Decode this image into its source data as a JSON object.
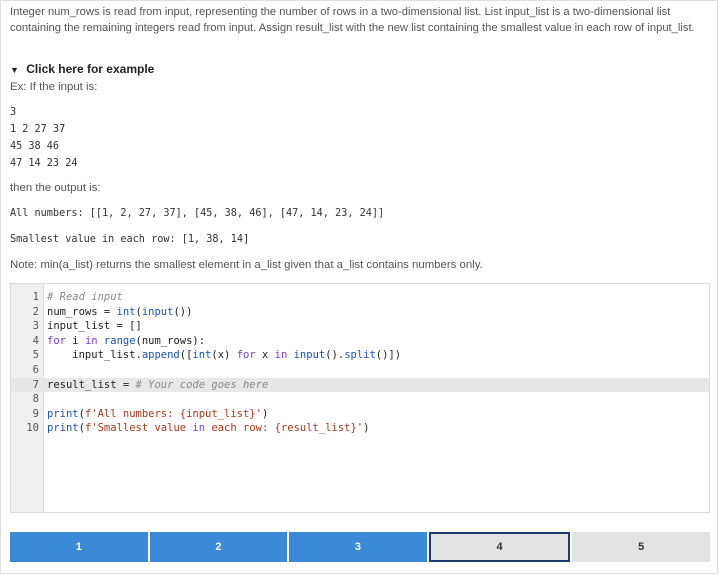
{
  "prompt": "Integer num_rows is read from input, representing the number of rows in a two-dimensional list. List input_list is a two-dimensional list containing the remaining integers read from input. Assign result_list with the new list containing the smallest value in each row of input_list.",
  "example": {
    "toggle_label": "Click here for example",
    "intro": "Ex: If the input is:",
    "input_lines": [
      "3",
      "1 2 27 37",
      "45 38 46",
      "47 14 23 24"
    ],
    "then_text": "then the output is:",
    "output_lines": [
      "All numbers: [[1, 2, 27, 37], [45, 38, 46], [47, 14, 23, 24]]",
      "Smallest value in each row: [1, 38, 14]"
    ],
    "note": "Note: min(a_list) returns the smallest element in a_list given that a_list contains numbers only."
  },
  "editor": {
    "active_line": 7,
    "lines": [
      {
        "n": "1",
        "code": "# Read input"
      },
      {
        "n": "2",
        "code": "num_rows = int(input())"
      },
      {
        "n": "3",
        "code": "input_list = []"
      },
      {
        "n": "4",
        "code": "for i in range(num_rows):"
      },
      {
        "n": "5",
        "code": "    input_list.append([int(x) for x in input().split()])"
      },
      {
        "n": "6",
        "code": ""
      },
      {
        "n": "7",
        "code": "result_list = # Your code goes here"
      },
      {
        "n": "8",
        "code": ""
      },
      {
        "n": "9",
        "code": "print(f'All numbers: {input_list}')"
      },
      {
        "n": "10",
        "code": "print(f'Smallest value in each row: {result_list}')"
      }
    ]
  },
  "progress": {
    "current": 4,
    "steps": [
      {
        "label": "1",
        "state": "completed"
      },
      {
        "label": "2",
        "state": "completed"
      },
      {
        "label": "3",
        "state": "completed"
      },
      {
        "label": "4",
        "state": "current"
      },
      {
        "label": "5",
        "state": "pending"
      }
    ]
  },
  "colors": {
    "accent": "#3c8ad7",
    "current_border": "#1f3a6d"
  }
}
